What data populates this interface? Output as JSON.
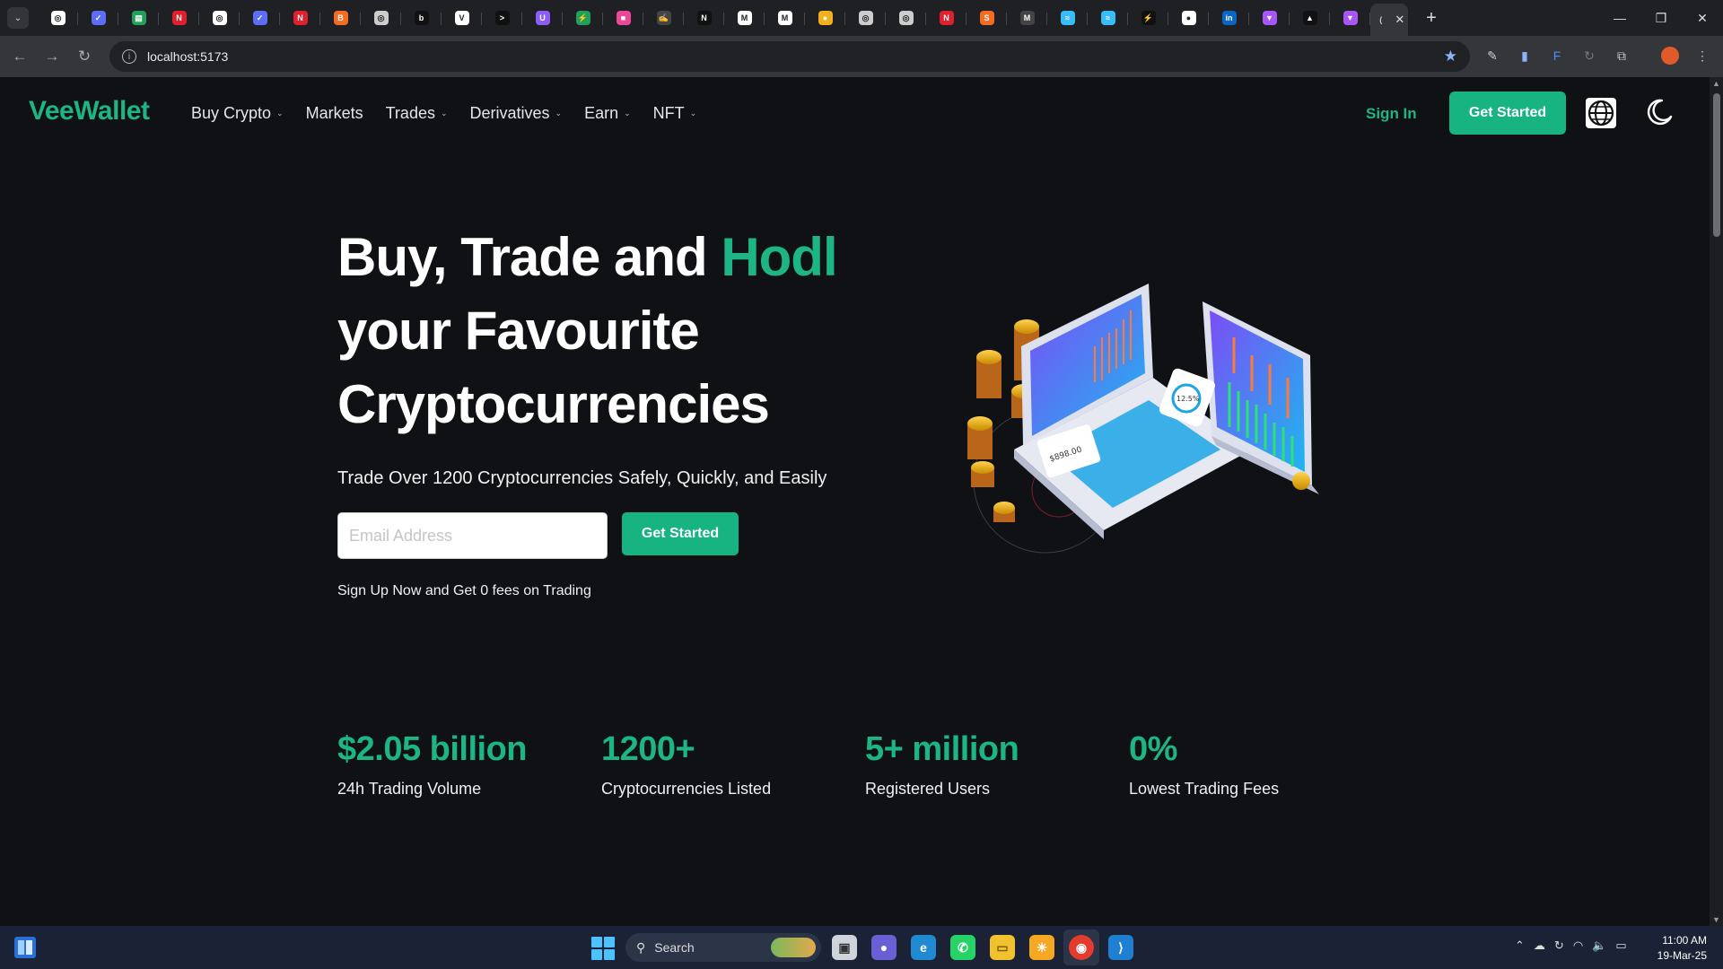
{
  "browser": {
    "url": "localhost:5173",
    "tabs": [
      {
        "icon": "gear-icon",
        "color": "#ffffff",
        "glyph": "◎"
      },
      {
        "icon": "grammar-icon",
        "color": "#5d6df5",
        "glyph": "✓"
      },
      {
        "icon": "sheets-icon",
        "color": "#22a05a",
        "glyph": "▤"
      },
      {
        "icon": "red-n-icon",
        "color": "#e0202c",
        "glyph": "N"
      },
      {
        "icon": "gear-icon",
        "color": "#ffffff",
        "glyph": "◎"
      },
      {
        "icon": "grammar-icon",
        "color": "#5d6df5",
        "glyph": "✓"
      },
      {
        "icon": "red-n-icon",
        "color": "#e0202c",
        "glyph": "N"
      },
      {
        "icon": "brave-icon",
        "color": "#f46b24",
        "glyph": "B"
      },
      {
        "icon": "gear-icon",
        "color": "#cccccc",
        "glyph": "◎"
      },
      {
        "icon": "b-icon",
        "color": "#111111",
        "glyph": "b"
      },
      {
        "icon": "vs-icon",
        "color": "#ffffff",
        "glyph": "V"
      },
      {
        "icon": "terminal-icon",
        "color": "#111111",
        "glyph": ">"
      },
      {
        "icon": "u-icon",
        "color": "#8b5cf6",
        "glyph": "U"
      },
      {
        "icon": "bolt-icon",
        "color": "#22a05a",
        "glyph": "⚡"
      },
      {
        "icon": "pink-icon",
        "color": "#ec4899",
        "glyph": "■"
      },
      {
        "icon": "signature-icon",
        "color": "#444444",
        "glyph": "✍"
      },
      {
        "icon": "n-icon",
        "color": "#111111",
        "glyph": "N"
      },
      {
        "icon": "medium-icon",
        "color": "#ffffff",
        "glyph": "M"
      },
      {
        "icon": "medium-icon",
        "color": "#ffffff",
        "glyph": "M"
      },
      {
        "icon": "chrome-icon",
        "color": "#f2b01e",
        "glyph": "●"
      },
      {
        "icon": "gear-icon",
        "color": "#cccccc",
        "glyph": "◎"
      },
      {
        "icon": "gear-icon",
        "color": "#cccccc",
        "glyph": "◎"
      },
      {
        "icon": "red-n-icon",
        "color": "#e0202c",
        "glyph": "N"
      },
      {
        "icon": "s-icon",
        "color": "#f46b24",
        "glyph": "S"
      },
      {
        "icon": "m-icon",
        "color": "#444444",
        "glyph": "M"
      },
      {
        "icon": "tailwind-icon",
        "color": "#38bdf8",
        "glyph": "≈"
      },
      {
        "icon": "tailwind-icon",
        "color": "#38bdf8",
        "glyph": "≈"
      },
      {
        "icon": "bolt-icon",
        "color": "#111111",
        "glyph": "⚡"
      },
      {
        "icon": "github-icon",
        "color": "#ffffff",
        "glyph": "●"
      },
      {
        "icon": "linkedin-icon",
        "color": "#0a66c2",
        "glyph": "in"
      },
      {
        "icon": "vite-icon",
        "color": "#a855f7",
        "glyph": "▼"
      },
      {
        "icon": "vercel-icon",
        "color": "#111111",
        "glyph": "▲"
      },
      {
        "icon": "vite-icon",
        "color": "#a855f7",
        "glyph": "▼"
      }
    ]
  },
  "nav": {
    "logo": "VeeWallet",
    "items": [
      {
        "label": "Buy Crypto",
        "has_dropdown": true
      },
      {
        "label": "Markets",
        "has_dropdown": false
      },
      {
        "label": "Trades",
        "has_dropdown": true
      },
      {
        "label": "Derivatives",
        "has_dropdown": true
      },
      {
        "label": "Earn",
        "has_dropdown": true
      },
      {
        "label": "NFT",
        "has_dropdown": true
      }
    ],
    "signin": "Sign In",
    "get_started": "Get Started"
  },
  "hero": {
    "title_line1_a": "Buy, Trade and ",
    "title_line1_accent": "Hodl",
    "title_line2": "your Favourite",
    "title_line3": "Cryptocurrencies",
    "subtitle": "Trade Over 1200 Cryptocurrencies Safely, Quickly, and Easily",
    "email_placeholder": "Email Address",
    "email_value": "",
    "cta": "Get Started",
    "note": "Sign Up Now and Get 0 fees on Trading",
    "illustration_labels": {
      "card_value": "$898.00",
      "ring_pct": "12.5%"
    }
  },
  "stats": [
    {
      "value": "$2.05 billion",
      "label": "24h Trading Volume"
    },
    {
      "value": "1200+",
      "label": "Cryptocurrencies Listed"
    },
    {
      "value": "5+ million",
      "label": "Registered Users"
    },
    {
      "value": "0%",
      "label": "Lowest Trading Fees"
    }
  ],
  "taskbar": {
    "search_label": "Search",
    "time": "11:00 AM",
    "date": "19-Mar-25"
  },
  "colors": {
    "accent": "#1db584",
    "background": "#101114",
    "button": "#17b380"
  }
}
